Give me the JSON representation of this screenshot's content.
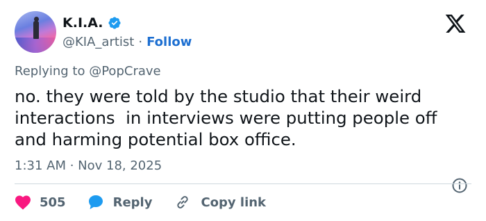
{
  "author": {
    "display_name": "K.I.A.",
    "handle": "@KIA_artist",
    "separator": "·",
    "follow_label": "Follow",
    "verified": true
  },
  "reply_context": {
    "prefix": "Replying to",
    "mention": "@PopCrave"
  },
  "tweet": {
    "text": "no. they were told by the studio that their weird\ninteractions  in interviews were putting people off\nand harming potential box office.",
    "timestamp": "1:31 AM · Nov 18, 2025"
  },
  "actions": {
    "like_count": "505",
    "reply_label": "Reply",
    "copy_label": "Copy link"
  },
  "colors": {
    "text": "#0f1419",
    "secondary": "#536471",
    "link": "#1d6fd1",
    "verified": "#1d9bf0",
    "like": "#f91880",
    "reply": "#1d9bf0",
    "divider": "#cfd9de"
  },
  "icons": [
    "verified-badge-icon",
    "x-logo-icon",
    "info-icon",
    "heart-icon",
    "reply-bubble-icon",
    "link-icon"
  ]
}
